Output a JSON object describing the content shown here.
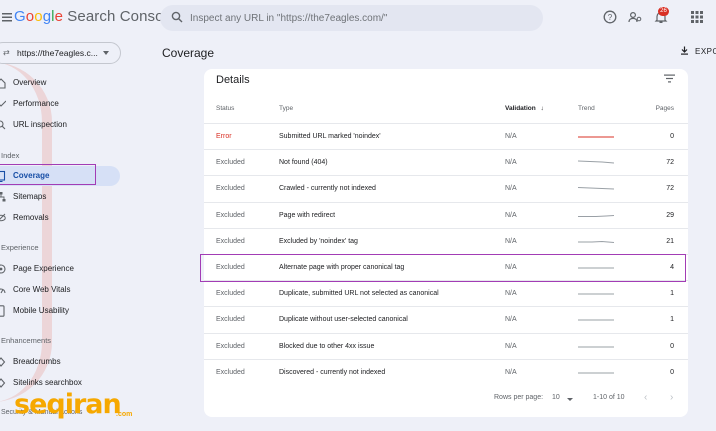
{
  "app": {
    "logo_word_1": "G",
    "logo_word_2": "o",
    "logo_word_3": "o",
    "logo_word_4": "g",
    "logo_word_5": "l",
    "logo_word_6": "e",
    "logo_rest": " Search Console"
  },
  "search": {
    "placeholder": "Inspect any URL in \"https://the7eagles.com/\""
  },
  "notifications": {
    "count": "26"
  },
  "property": {
    "label": "https://the7eagles.c..."
  },
  "sidebar": {
    "items_top": [
      {
        "label": "Overview"
      },
      {
        "label": "Performance"
      },
      {
        "label": "URL inspection"
      }
    ],
    "index_title": "Index",
    "index_items": [
      {
        "label": "Coverage"
      },
      {
        "label": "Sitemaps"
      },
      {
        "label": "Removals"
      }
    ],
    "experience_title": "Experience",
    "experience_items": [
      {
        "label": "Page Experience"
      },
      {
        "label": "Core Web Vitals"
      },
      {
        "label": "Mobile Usability"
      }
    ],
    "enhancements_title": "Enhancements",
    "enhancements_items": [
      {
        "label": "Breadcrumbs"
      },
      {
        "label": "Sitelinks searchbox"
      }
    ],
    "security_title": "Security & Manual Actions"
  },
  "main": {
    "title": "Coverage",
    "export_label": "EXPO"
  },
  "details": {
    "title": "Details",
    "headers": {
      "status": "Status",
      "type": "Type",
      "validation": "Validation",
      "trend": "Trend",
      "pages": "Pages"
    },
    "rows": [
      {
        "status": "Error",
        "type": "Submitted URL marked 'noindex'",
        "validation": "N/A",
        "pages": "0"
      },
      {
        "status": "Excluded",
        "type": "Not found (404)",
        "validation": "N/A",
        "pages": "72"
      },
      {
        "status": "Excluded",
        "type": "Crawled - currently not indexed",
        "validation": "N/A",
        "pages": "72"
      },
      {
        "status": "Excluded",
        "type": "Page with redirect",
        "validation": "N/A",
        "pages": "29"
      },
      {
        "status": "Excluded",
        "type": "Excluded by 'noindex' tag",
        "validation": "N/A",
        "pages": "21"
      },
      {
        "status": "Excluded",
        "type": "Alternate page with proper canonical tag",
        "validation": "N/A",
        "pages": "4"
      },
      {
        "status": "Excluded",
        "type": "Duplicate, submitted URL not selected as canonical",
        "validation": "N/A",
        "pages": "1"
      },
      {
        "status": "Excluded",
        "type": "Duplicate without user-selected canonical",
        "validation": "N/A",
        "pages": "1"
      },
      {
        "status": "Excluded",
        "type": "Blocked due to other 4xx issue",
        "validation": "N/A",
        "pages": "0"
      },
      {
        "status": "Excluded",
        "type": "Discovered - currently not indexed",
        "validation": "N/A",
        "pages": "0"
      }
    ],
    "footer": {
      "rows_per_page_label": "Rows per page:",
      "rows_per_page_value": "10",
      "range": "1-10 of 10"
    }
  },
  "watermark": {
    "brand": "seqiran",
    "tld": ".com"
  },
  "colors": {
    "accent": "#174ea6",
    "highlight": "#a23cb5",
    "error": "#d93025",
    "brand": "#f6a800"
  }
}
